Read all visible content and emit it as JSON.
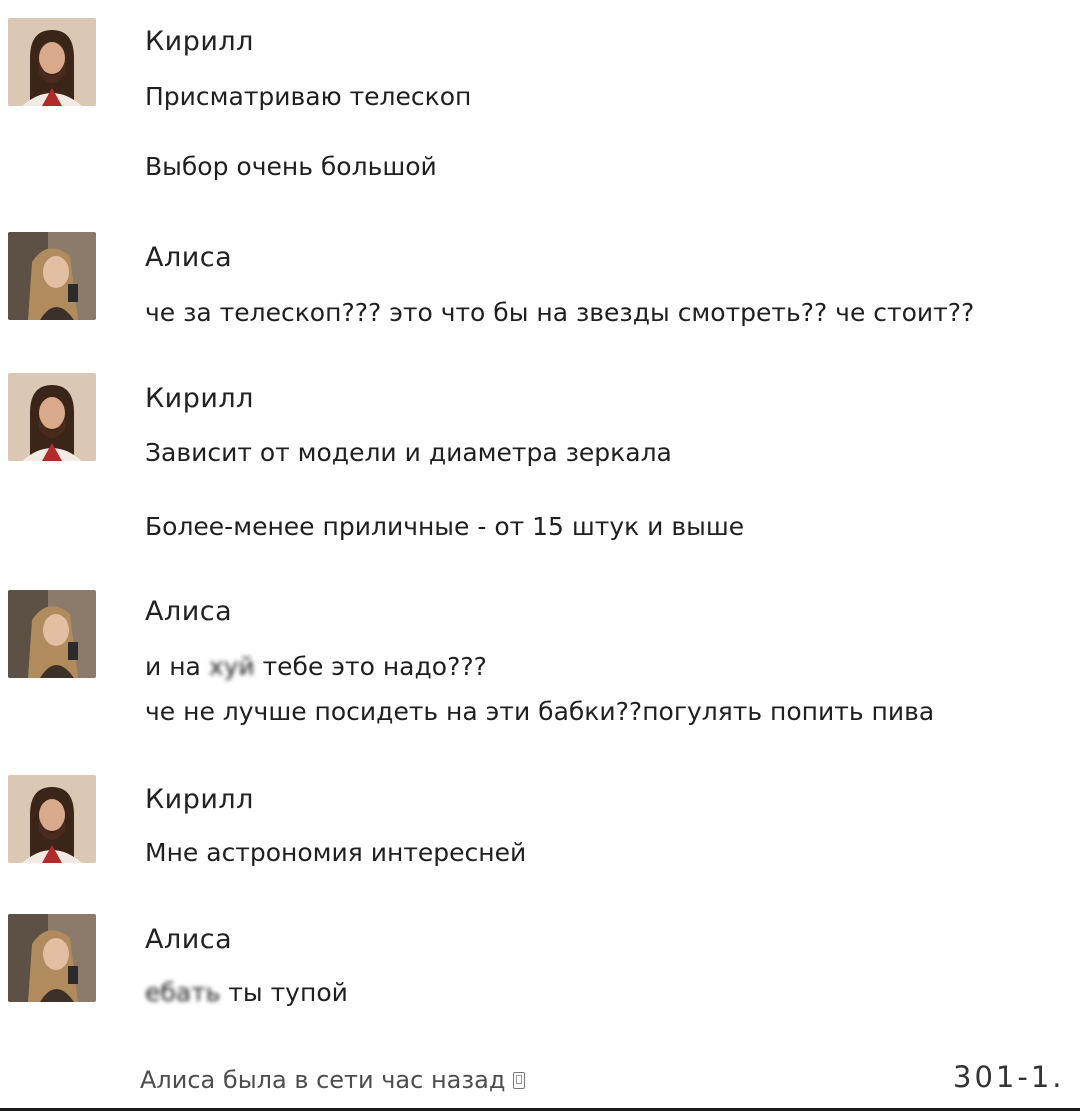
{
  "messages": [
    {
      "author": "Кирилл",
      "avatar": "jesus-avatar",
      "lines": [
        {
          "text": "Присматриваю телескоп"
        },
        {
          "text": "Выбор очень большой"
        }
      ]
    },
    {
      "author": "Алиса",
      "avatar": "girl-avatar",
      "lines": [
        {
          "text": "че за телескоп??? это что бы на звезды смотреть?? че стоит??"
        }
      ]
    },
    {
      "author": "Кирилл",
      "avatar": "jesus-avatar",
      "lines": [
        {
          "text": "Зависит от модели и диаметра зеркала"
        },
        {
          "text": "Более-менее приличные - от 15 штук и выше"
        }
      ]
    },
    {
      "author": "Алиса",
      "avatar": "girl-avatar",
      "lines": [
        {
          "pre": "и на ",
          "blurred": "хуй",
          "post": " тебе это надо???"
        },
        {
          "text": "че не лучше посидеть на эти бабки??погулять попить пива"
        }
      ]
    },
    {
      "author": "Кирилл",
      "avatar": "jesus-avatar",
      "lines": [
        {
          "text": "Мне астрономия интересней"
        }
      ]
    },
    {
      "author": "Алиса",
      "avatar": "girl-avatar",
      "lines": [
        {
          "pre": "",
          "blurred": "ебать",
          "post": " ты тупой"
        }
      ]
    }
  ],
  "footer": {
    "status": "Алиса была в сети час назад",
    "status_icon": "mobile-phone-icon",
    "counter": "301-1."
  }
}
